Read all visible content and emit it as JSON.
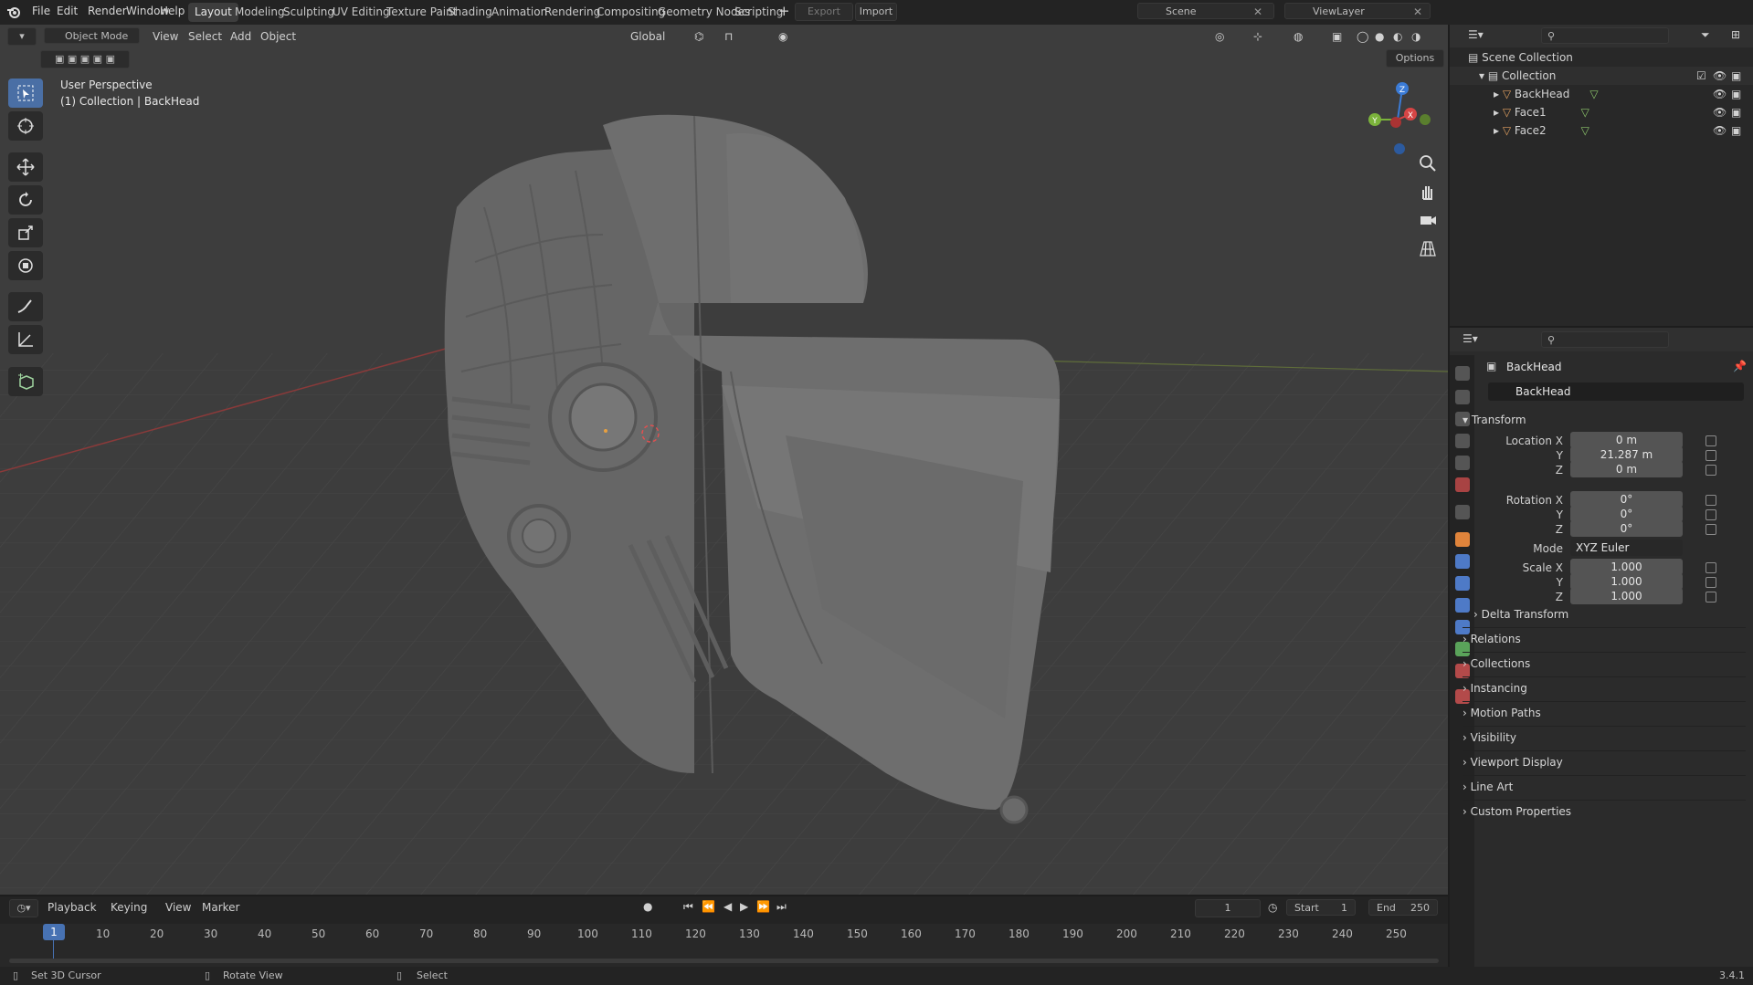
{
  "top_menu": [
    "File",
    "Edit",
    "Render",
    "Window",
    "Help"
  ],
  "workspaces": [
    "Layout",
    "Modeling",
    "Sculpting",
    "UV Editing",
    "Texture Paint",
    "Shading",
    "Animation",
    "Rendering",
    "Compositing",
    "Geometry Nodes",
    "Scripting"
  ],
  "active_workspace": "Layout",
  "top_buttons": {
    "export": "Export",
    "import": "Import"
  },
  "scene_name": "Scene",
  "viewlayer_name": "ViewLayer",
  "viewport": {
    "mode": "Object Mode",
    "menus": [
      "View",
      "Select",
      "Add",
      "Object"
    ],
    "orientation": "Global",
    "options_label": "Options",
    "perspective_text": "User Perspective",
    "context_text": "(1) Collection | BackHead",
    "gizmo_axes": {
      "x": "X",
      "y": "Y",
      "z": "Z"
    }
  },
  "outliner": {
    "scene_collection": "Scene Collection",
    "collection": "Collection",
    "objects": [
      "BackHead",
      "Face1",
      "Face2"
    ]
  },
  "properties": {
    "object_name": "BackHead",
    "data_name": "BackHead",
    "transform_header": "Transform",
    "location_label": "Location X",
    "location": [
      "0 m",
      "21.287 m",
      "0 m"
    ],
    "rotation_label": "Rotation X",
    "rotation": [
      "0°",
      "0°",
      "0°"
    ],
    "mode_label": "Mode",
    "mode_value": "XYZ Euler",
    "scale_label": "Scale X",
    "scale": [
      "1.000",
      "1.000",
      "1.000"
    ],
    "axis_y": "Y",
    "axis_z": "Z",
    "delta_transform": "Delta Transform",
    "sections": [
      "Relations",
      "Collections",
      "Instancing",
      "Motion Paths",
      "Visibility",
      "Viewport Display",
      "Line Art",
      "Custom Properties"
    ]
  },
  "timeline": {
    "menus": [
      "Playback",
      "Keying",
      "View",
      "Marker"
    ],
    "current_frame": "1",
    "start_label": "Start",
    "start": "1",
    "end_label": "End",
    "end": "250",
    "ticks": [
      "1",
      "10",
      "20",
      "30",
      "40",
      "50",
      "60",
      "70",
      "80",
      "90",
      "100",
      "110",
      "120",
      "130",
      "140",
      "150",
      "160",
      "170",
      "180",
      "190",
      "200",
      "210",
      "220",
      "230",
      "240",
      "250"
    ]
  },
  "statusbar": {
    "left": "Set 3D Cursor",
    "middle": "Rotate View",
    "right": "Select",
    "version": "3.4.1"
  },
  "colors": {
    "accent": "#4a6fa5",
    "frame_marker": "#4772b3",
    "viewport_bg": "#3d3d3d",
    "mesh": "#6a6a6a"
  }
}
